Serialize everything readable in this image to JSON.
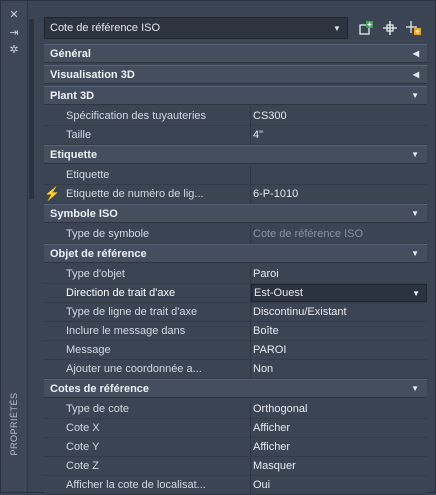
{
  "palette": {
    "title": "PROPRIÉTÉS"
  },
  "toolbar": {
    "selector_value": "Cote de référence ISO",
    "buttons": [
      {
        "name": "quick-select-icon"
      },
      {
        "name": "select-objects-icon"
      },
      {
        "name": "toggle-pickadd-icon"
      }
    ]
  },
  "sections": [
    {
      "title": "Général",
      "expanded": false,
      "rows": []
    },
    {
      "title": "Visualisation 3D",
      "expanded": false,
      "rows": []
    },
    {
      "title": "Plant 3D",
      "expanded": true,
      "rows": [
        {
          "label": "Spécification des tuyauteries",
          "value": "CS300"
        },
        {
          "label": "Taille",
          "value": "4\""
        }
      ]
    },
    {
      "title": "Etiquette",
      "expanded": true,
      "rows": [
        {
          "label": "Etiquette",
          "value": ""
        },
        {
          "label": "Etiquette de numéro de lig...",
          "value": "6-P-1010"
        }
      ]
    },
    {
      "title": "Symbole ISO",
      "expanded": true,
      "rows": [
        {
          "label": "Type de symbole",
          "value": "Cote de référence ISO"
        }
      ]
    },
    {
      "title": "Objet de référence",
      "expanded": true,
      "rows": [
        {
          "label": "Type d'objet",
          "value": "Paroi"
        },
        {
          "label": "Direction de trait d'axe",
          "value": "Est-Ouest"
        },
        {
          "label": "Type de ligne de trait d'axe",
          "value": "Discontinu/Existant"
        },
        {
          "label": "Inclure le message dans",
          "value": "Boîte"
        },
        {
          "label": "Message",
          "value": "PAROI"
        },
        {
          "label": "Ajouter une coordonnée a...",
          "value": "Non"
        }
      ]
    },
    {
      "title": "Cotes de référence",
      "expanded": true,
      "rows": [
        {
          "label": "Type de cote",
          "value": "Orthogonal"
        },
        {
          "label": "Cote X",
          "value": "Afficher"
        },
        {
          "label": "Cote Y",
          "value": "Afficher"
        },
        {
          "label": "Cote Z",
          "value": "Masquer"
        },
        {
          "label": "Afficher la cote de localisat...",
          "value": "Oui"
        }
      ]
    }
  ]
}
